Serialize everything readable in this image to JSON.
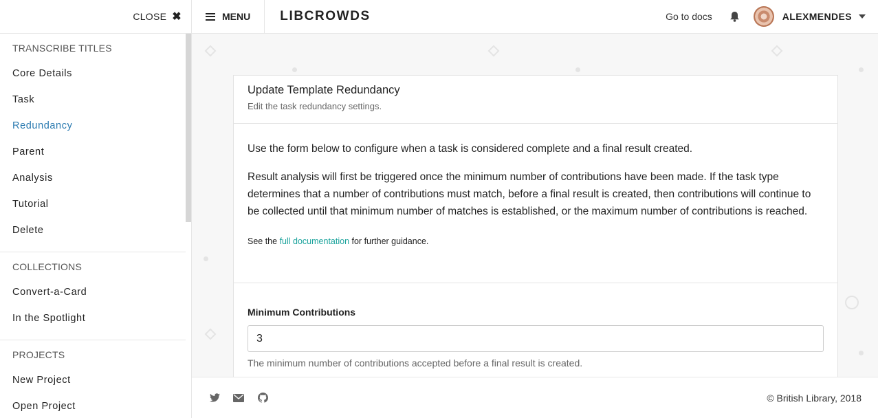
{
  "sidebar": {
    "close_label": "CLOSE",
    "sections": [
      {
        "heading": "TRANSCRIBE TITLES",
        "items": [
          "Core Details",
          "Task",
          "Redundancy",
          "Parent",
          "Analysis",
          "Tutorial",
          "Delete"
        ],
        "active": "Redundancy"
      },
      {
        "heading": "COLLECTIONS",
        "items": [
          "Convert-a-Card",
          "In the Spotlight"
        ]
      },
      {
        "heading": "PROJECTS",
        "items": [
          "New Project",
          "Open Project"
        ]
      }
    ]
  },
  "topbar": {
    "menu_label": "MENU",
    "brand": "LIBCROWDS",
    "docs_link": "Go to docs",
    "username": "ALEXMENDES"
  },
  "card": {
    "title": "Update Template Redundancy",
    "subtitle": "Edit the task redundancy settings.",
    "intro": "Use the form below to configure when a task is considered complete and a final result created.",
    "details": "Result analysis will first be triggered once the minimum number of contributions have been made. If the task type determines that a number of contributions must match, before a final result is created, then contributions will continue to be collected until that minimum number of matches is established, or the maximum number of contributions is reached.",
    "docs_prefix": "See the ",
    "docs_link": "full documentation",
    "docs_suffix": " for further guidance.",
    "field": {
      "label": "Minimum Contributions",
      "value": "3",
      "help": "The minimum number of contributions accepted before a final result is created."
    }
  },
  "footer": {
    "icons": [
      "twitter-icon",
      "email-icon",
      "github-icon"
    ],
    "copyright": "© British Library, 2018"
  },
  "colors": {
    "active_link": "#2a7ab0",
    "doc_link": "#1ba39c"
  }
}
